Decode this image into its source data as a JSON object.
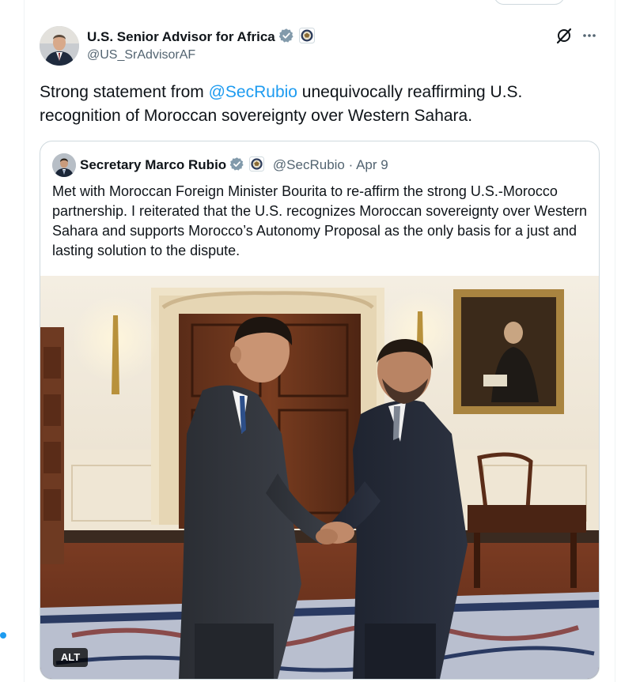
{
  "tweet": {
    "author_name": "U.S. Senior Advisor for Africa",
    "author_handle": "@US_SrAdvisorAF",
    "text_before": "Strong statement from ",
    "mention": "@SecRubio",
    "text_after": "  unequivocally reaffirming U.S. recognition of Moroccan sovereignty over Western Sahara."
  },
  "quote": {
    "author_name": "Secretary Marco Rubio",
    "author_handle": "@SecRubio",
    "separator": "·",
    "date": "Apr 9",
    "text": "Met with Moroccan Foreign Minister Bourita to re-affirm the strong U.S.-Morocco partnership. I reiterated that the U.S. recognizes Moroccan sovereignty over Western Sahara and supports Morocco’s Autonomy Proposal as the only basis for a just and lasting solution to the dispute.",
    "alt_label": "ALT"
  },
  "icons": {
    "verified": "verified-badge-icon",
    "government_seal": "government-seal-icon",
    "grok": "grok-icon",
    "more": "more-options-icon"
  },
  "colors": {
    "accent": "#1d9bf0",
    "text_primary": "#0f1419",
    "text_secondary": "#536471",
    "border": "#cfd9de",
    "verified_gray": "#829aab"
  }
}
